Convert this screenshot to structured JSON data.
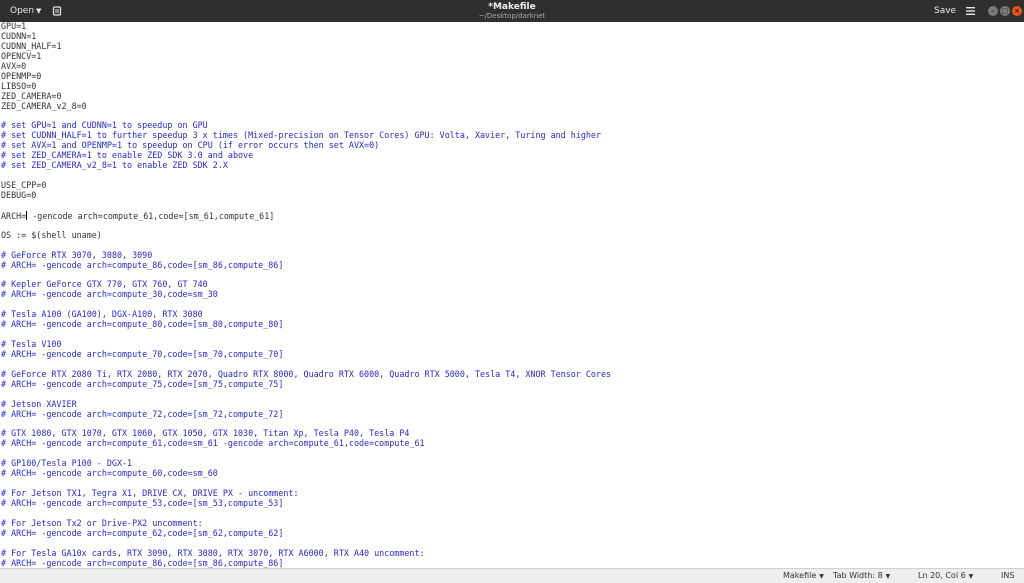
{
  "header": {
    "open_label": "Open",
    "title": "*Makefile",
    "subtitle": "~/Desktop/darknet",
    "save_label": "Save",
    "window_buttons": {
      "minimize": "–",
      "maximize": "□",
      "close": "×"
    }
  },
  "editor": {
    "cursor": {
      "line": 20,
      "column": 6
    },
    "lines": [
      {
        "text": "GPU=1",
        "kind": "plain"
      },
      {
        "text": "CUDNN=1",
        "kind": "plain"
      },
      {
        "text": "CUDNN_HALF=1",
        "kind": "plain"
      },
      {
        "text": "OPENCV=1",
        "kind": "plain"
      },
      {
        "text": "AVX=0",
        "kind": "plain"
      },
      {
        "text": "OPENMP=0",
        "kind": "plain"
      },
      {
        "text": "LIBSO=0",
        "kind": "plain"
      },
      {
        "text": "ZED_CAMERA=0",
        "kind": "plain"
      },
      {
        "text": "ZED_CAMERA_v2_8=0",
        "kind": "plain"
      },
      {
        "text": "",
        "kind": "plain"
      },
      {
        "text": "# set GPU=1 and CUDNN=1 to speedup on GPU",
        "kind": "comment"
      },
      {
        "text": "# set CUDNN_HALF=1 to further speedup 3 x times (Mixed-precision on Tensor Cores) GPU: Volta, Xavier, Turing and higher",
        "kind": "comment"
      },
      {
        "text": "# set AVX=1 and OPENMP=1 to speedup on CPU (if error occurs then set AVX=0)",
        "kind": "comment"
      },
      {
        "text": "# set ZED_CAMERA=1 to enable ZED SDK 3.0 and above",
        "kind": "comment"
      },
      {
        "text": "# set ZED_CAMERA_v2_8=1 to enable ZED SDK 2.X",
        "kind": "comment"
      },
      {
        "text": "",
        "kind": "plain"
      },
      {
        "text": "USE_CPP=0",
        "kind": "plain"
      },
      {
        "text": "DEBUG=0",
        "kind": "plain"
      },
      {
        "text": "",
        "kind": "plain"
      },
      {
        "text": "ARCH= -gencode arch=compute_61,code=[sm_61,compute_61]",
        "kind": "plain"
      },
      {
        "text": "",
        "kind": "plain"
      },
      {
        "text": "OS := $(shell uname)",
        "kind": "plain"
      },
      {
        "text": "",
        "kind": "plain"
      },
      {
        "text": "# GeForce RTX 3070, 3080, 3090",
        "kind": "comment"
      },
      {
        "text": "# ARCH= -gencode arch=compute_86,code=[sm_86,compute_86]",
        "kind": "comment"
      },
      {
        "text": "",
        "kind": "plain"
      },
      {
        "text": "# Kepler GeForce GTX 770, GTX 760, GT 740",
        "kind": "comment"
      },
      {
        "text": "# ARCH= -gencode arch=compute_30,code=sm_30",
        "kind": "comment"
      },
      {
        "text": "",
        "kind": "plain"
      },
      {
        "text": "# Tesla A100 (GA100), DGX-A100, RTX 3080",
        "kind": "comment"
      },
      {
        "text": "# ARCH= -gencode arch=compute_80,code=[sm_80,compute_80]",
        "kind": "comment"
      },
      {
        "text": "",
        "kind": "plain"
      },
      {
        "text": "# Tesla V100",
        "kind": "comment"
      },
      {
        "text": "# ARCH= -gencode arch=compute_70,code=[sm_70,compute_70]",
        "kind": "comment"
      },
      {
        "text": "",
        "kind": "plain"
      },
      {
        "text": "# GeForce RTX 2080 Ti, RTX 2080, RTX 2070, Quadro RTX 8000, Quadro RTX 6000, Quadro RTX 5000, Tesla T4, XNOR Tensor Cores",
        "kind": "comment"
      },
      {
        "text": "# ARCH= -gencode arch=compute_75,code=[sm_75,compute_75]",
        "kind": "comment"
      },
      {
        "text": "",
        "kind": "plain"
      },
      {
        "text": "# Jetson XAVIER",
        "kind": "comment"
      },
      {
        "text": "# ARCH= -gencode arch=compute_72,code=[sm_72,compute_72]",
        "kind": "comment"
      },
      {
        "text": "",
        "kind": "plain"
      },
      {
        "text": "# GTX 1080, GTX 1070, GTX 1060, GTX 1050, GTX 1030, Titan Xp, Tesla P40, Tesla P4",
        "kind": "comment"
      },
      {
        "text": "# ARCH= -gencode arch=compute_61,code=sm_61 -gencode arch=compute_61,code=compute_61",
        "kind": "comment"
      },
      {
        "text": "",
        "kind": "plain"
      },
      {
        "text": "# GP100/Tesla P100 - DGX-1",
        "kind": "comment"
      },
      {
        "text": "# ARCH= -gencode arch=compute_60,code=sm_60",
        "kind": "comment"
      },
      {
        "text": "",
        "kind": "plain"
      },
      {
        "text": "# For Jetson TX1, Tegra X1, DRIVE CX, DRIVE PX - uncomment:",
        "kind": "comment"
      },
      {
        "text": "# ARCH= -gencode arch=compute_53,code=[sm_53,compute_53]",
        "kind": "comment"
      },
      {
        "text": "",
        "kind": "plain"
      },
      {
        "text": "# For Jetson Tx2 or Drive-PX2 uncomment:",
        "kind": "comment"
      },
      {
        "text": "# ARCH= -gencode arch=compute_62,code=[sm_62,compute_62]",
        "kind": "comment"
      },
      {
        "text": "",
        "kind": "plain"
      },
      {
        "text": "# For Tesla GA10x cards, RTX 3090, RTX 3080, RTX 3070, RTX A6000, RTX A40 uncomment:",
        "kind": "comment"
      },
      {
        "text": "# ARCH= -gencode arch=compute_86,code=[sm_86,compute_86]",
        "kind": "comment"
      }
    ]
  },
  "statusbar": {
    "language": "Makefile",
    "tab_width": "Tab Width: 8",
    "position": "Ln 20, Col 6",
    "mode": "INS"
  },
  "colors": {
    "titlebar": "#2f2f2d",
    "comment": "#2a2ac9",
    "plain_text": "#2e3436",
    "close_button": "#e95420"
  }
}
